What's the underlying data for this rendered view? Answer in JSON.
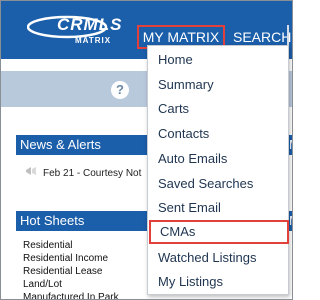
{
  "header": {
    "logo_main": "CRMLS",
    "logo_sub": "MATRIX",
    "nav": [
      {
        "label": "MY MATRIX"
      },
      {
        "label": "SEARCH"
      }
    ]
  },
  "toolbar": {
    "help_glyph": "?"
  },
  "news": {
    "title": "News & Alerts",
    "right_title_fragment": "M",
    "item": "Feb 21 - Courtesy Not"
  },
  "hot_sheets": {
    "title": "Hot Sheets",
    "right_title_fragment": "M",
    "items": [
      "Residential",
      "Residential Income",
      "Residential Lease",
      "Land/Lot",
      "Manufactured In Park"
    ]
  },
  "dropdown": {
    "items": [
      {
        "label": "Home"
      },
      {
        "label": "Summary"
      },
      {
        "label": "Carts"
      },
      {
        "label": "Contacts"
      },
      {
        "label": "Auto Emails"
      },
      {
        "label": "Saved Searches"
      },
      {
        "label": "Sent Email"
      },
      {
        "label": "CMAs"
      },
      {
        "label": "Watched Listings"
      },
      {
        "label": "My Listings"
      }
    ]
  },
  "colors": {
    "header_blue": "#1b5ea9",
    "highlight_red": "#e2403a",
    "toolbar_gray_blue": "#b9c9dc"
  },
  "icons": [
    "help-icon",
    "megaphone-icon"
  ]
}
